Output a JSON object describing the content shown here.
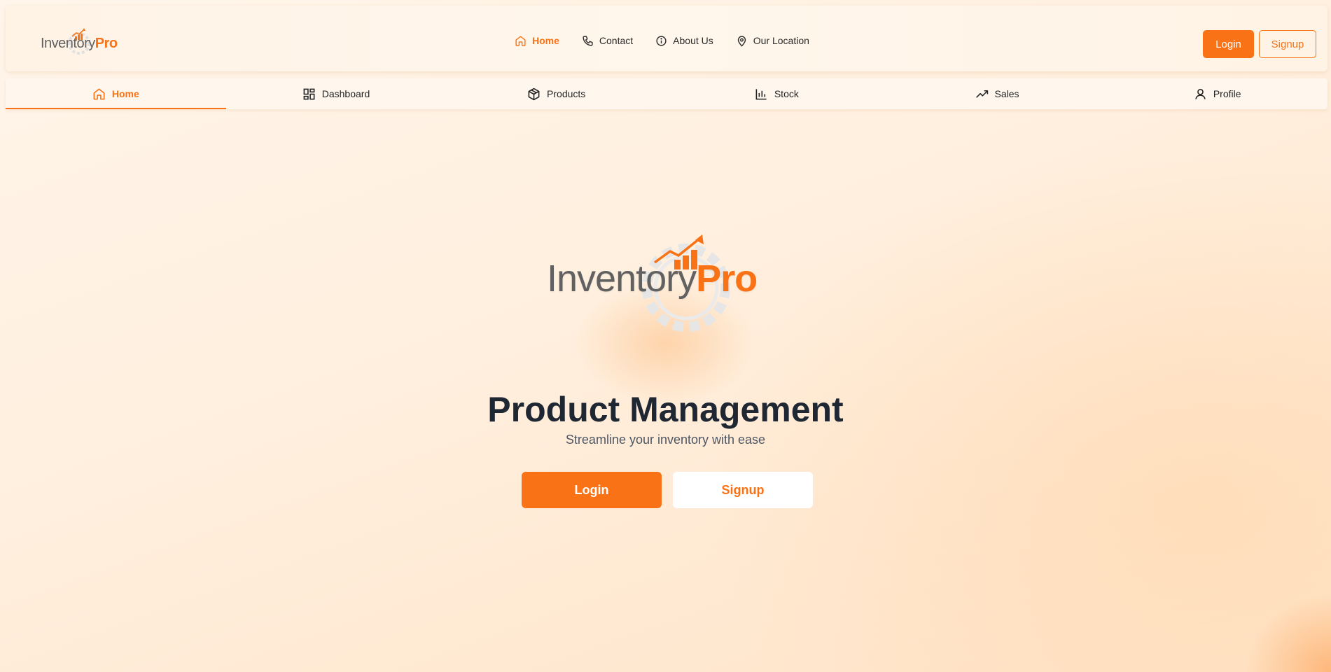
{
  "brand": {
    "name_part1": "Invent",
    "name_part1b": "ry",
    "name_part2": "Pro",
    "accent_color": "#f97316",
    "text_gray": "#5f5f5f"
  },
  "top_nav": {
    "links": [
      {
        "label": "Home",
        "icon": "home-icon",
        "active": true
      },
      {
        "label": "Contact",
        "icon": "phone-icon",
        "active": false
      },
      {
        "label": "About Us",
        "icon": "info-icon",
        "active": false
      },
      {
        "label": "Our Location",
        "icon": "map-pin-icon",
        "active": false
      }
    ],
    "login_label": "Login",
    "signup_label": "Signup"
  },
  "tabs": [
    {
      "label": "Home",
      "icon": "home-icon",
      "active": true
    },
    {
      "label": "Dashboard",
      "icon": "dashboard-icon",
      "active": false
    },
    {
      "label": "Products",
      "icon": "box-icon",
      "active": false
    },
    {
      "label": "Stock",
      "icon": "bar-chart-icon",
      "active": false
    },
    {
      "label": "Sales",
      "icon": "trending-up-icon",
      "active": false
    },
    {
      "label": "Profile",
      "icon": "user-icon",
      "active": false
    }
  ],
  "hero": {
    "title": "Product Management",
    "subtitle": "Streamline your inventory with ease",
    "login_label": "Login",
    "signup_label": "Signup"
  }
}
